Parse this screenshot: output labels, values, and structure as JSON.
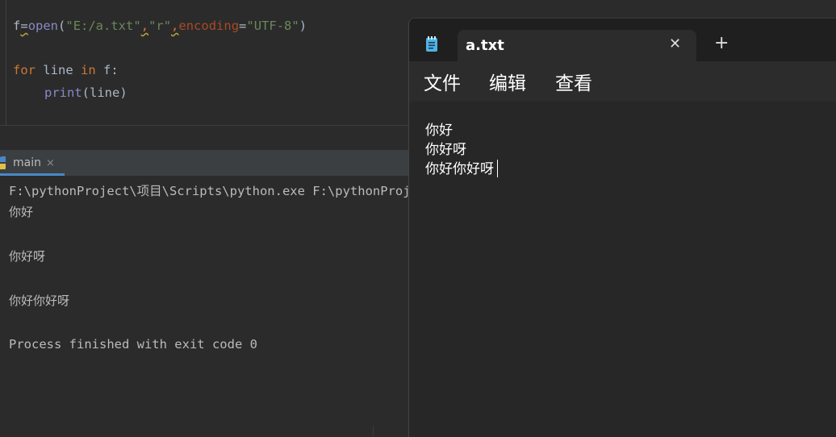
{
  "editor": {
    "line1": {
      "f": "f",
      "eq": "=",
      "open": "open",
      "lp": "(",
      "path": "\"E:/a.txt\"",
      "c1": ",",
      "mode": "\"r\"",
      "c2": ",",
      "enc_kw": "encoding",
      "eq2": "=",
      "enc_val": "\"UTF-8\"",
      "rp": ")"
    },
    "line2": {
      "for": "for",
      "line": " line ",
      "in": "in",
      "rest": " f:"
    },
    "line3": {
      "print": "print",
      "args": "(line)"
    }
  },
  "run": {
    "tab_label": "main",
    "tab_close": "×",
    "console": [
      "F:\\pythonProject\\项目\\Scripts\\python.exe F:\\pythonProject\\",
      "你好",
      "你好呀",
      "你好你好呀",
      "Process finished with exit code 0"
    ]
  },
  "notepad": {
    "tab_title": "a.txt",
    "tab_close": "✕",
    "new_tab": "+",
    "menu": {
      "file": "文件",
      "edit": "编辑",
      "view": "查看"
    },
    "lines": [
      "你好",
      "你好呀",
      "你好你好呀"
    ]
  },
  "colors": {
    "keyword": "#cc7832",
    "function": "#8888c6",
    "string": "#6a8759",
    "named_param": "#aa4926",
    "tab_underline": "#4a88c7"
  }
}
